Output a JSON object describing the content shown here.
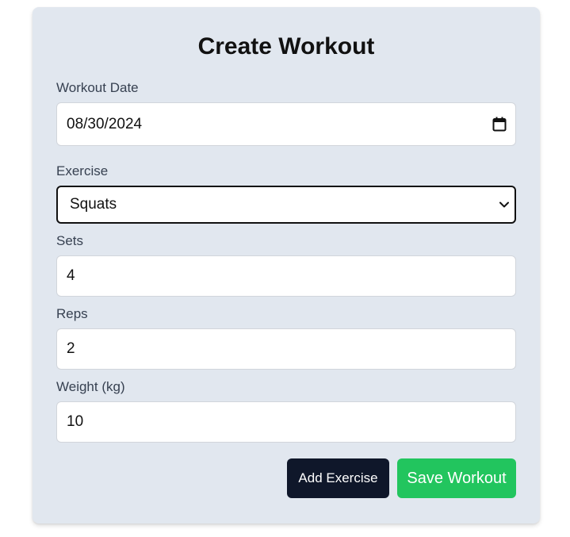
{
  "form": {
    "title": "Create Workout",
    "date_label": "Workout Date",
    "date_value": "08/30/2024",
    "exercise_label": "Exercise",
    "exercise_value": "Squats",
    "sets_label": "Sets",
    "sets_value": "4",
    "reps_label": "Reps",
    "reps_value": "2",
    "weight_label": "Weight (kg)",
    "weight_value": "10"
  },
  "buttons": {
    "add_exercise": "Add Exercise",
    "save_workout": "Save Workout"
  },
  "colors": {
    "card_background": "#e1e7ef",
    "add_button": "#0f172a",
    "save_button": "#22c55e"
  },
  "icons": {
    "date": "calendar-icon",
    "select": "chevron-down-icon"
  }
}
